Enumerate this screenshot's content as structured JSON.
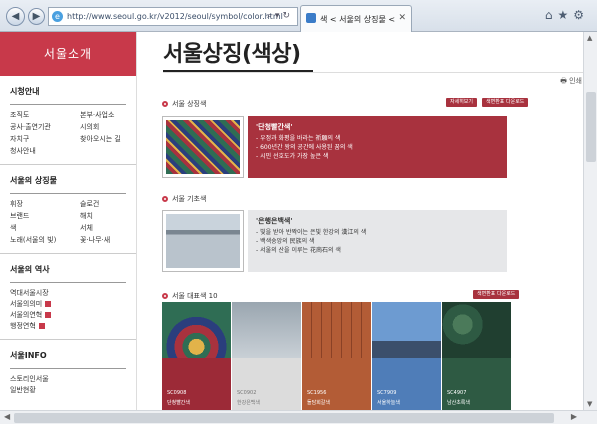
{
  "browser": {
    "url": "http://www.seoul.go.kr/v2012/seoul/symbol/color.html",
    "tab_title": "색 < 서울의 상징물 < 서울...",
    "back_icon": "back-arrow-icon",
    "forward_icon": "forward-arrow-icon",
    "toolbar_icons": [
      "home-icon",
      "star-icon",
      "gear-icon"
    ]
  },
  "sidebar": {
    "title": "서울소개",
    "sections": [
      {
        "heading": "시청안내",
        "items": [
          "조직도",
          "본부·사업소",
          "공사·출연기관",
          "시의회",
          "자치구",
          "찾아오시는 길",
          "청사안내"
        ]
      },
      {
        "heading": "서울의 상징물",
        "items": [
          "휘장",
          "슬로건",
          "브랜드",
          "해치",
          "색",
          "서체",
          "노래(서울의 빛)",
          "꽃·나무·새"
        ]
      },
      {
        "heading": "서울의 역사",
        "items": [
          {
            "label": "역대서울시장",
            "badge": false
          },
          {
            "label": "서울의의미",
            "badge": true
          },
          {
            "label": "서울의연혁",
            "badge": true
          },
          {
            "label": "행정연혁",
            "badge": true
          }
        ]
      },
      {
        "heading": "서울INFO",
        "items": [
          "스토리인서울",
          "일반현황"
        ]
      }
    ]
  },
  "main": {
    "title": "서울상징(색상)",
    "print_label": "인쇄",
    "sec1": {
      "heading": "서울 상징색",
      "btn1": "자세히보기",
      "btn2": "색변환표 다운로드",
      "desc_title": "'단청빨간색'",
      "lines": [
        "- 우정과 화평을 바라는 祈願의 색",
        "- 600년간 왕의 공간에 사용된 꿈의 색",
        "- 시민 선호도가 가장 높은 색"
      ],
      "color": "#a8323e"
    },
    "sec2": {
      "heading": "서울 기초색",
      "desc_title": "'은행은백색'",
      "lines": [
        "- 빛을 받아 반짝이는 은빛 한강의 漢江의 색",
        "- 백색숭앙의 民族의 색",
        "- 서울의 산을 이루는 花崗石의 색"
      ],
      "color": "#e6e7e9"
    },
    "sec3": {
      "heading": "서울 대표색 10",
      "btn": "색변환표 다운로드",
      "swatches": [
        {
          "code": "SC0908",
          "name": "단청빨간색",
          "color": "#9c2a37"
        },
        {
          "code": "SC0902",
          "name": "한강은백색",
          "color": "#dcdcdc"
        },
        {
          "code": "SC1956",
          "name": "돌담회갈색",
          "color": "#b35c36"
        },
        {
          "code": "SC7909",
          "name": "서울하늘색",
          "color": "#4f7db8"
        },
        {
          "code": "SC4907",
          "name": "남산초록색",
          "color": "#2e5a43"
        }
      ]
    }
  }
}
